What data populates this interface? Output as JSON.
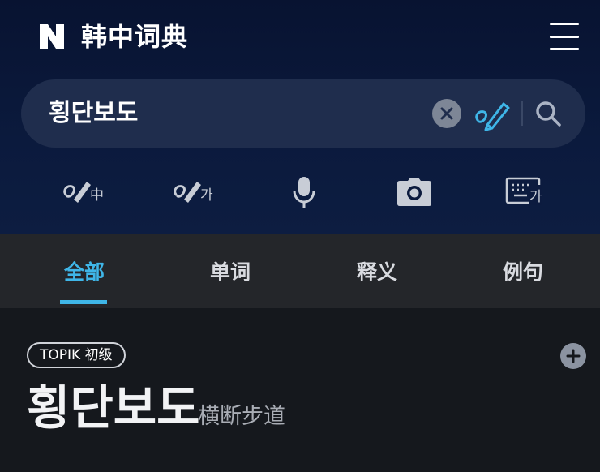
{
  "app": {
    "logo_icon": "naver-n-logo-icon",
    "title": "韩中词典",
    "menu_icon": "hamburger-menu-icon"
  },
  "search": {
    "query": "횡단보도",
    "clear_icon": "clear-icon",
    "handwriting_icon": "handwriting-pen-icon",
    "search_icon": "search-icon"
  },
  "input_tools": [
    {
      "name": "chinese-handwriting-icon",
      "sub": "中"
    },
    {
      "name": "korean-handwriting-icon",
      "sub": "가"
    },
    {
      "name": "microphone-icon"
    },
    {
      "name": "camera-icon"
    },
    {
      "name": "korean-keyboard-icon",
      "sub": "가"
    }
  ],
  "tabs": [
    {
      "label": "全部",
      "active": true
    },
    {
      "label": "单词",
      "active": false
    },
    {
      "label": "释义",
      "active": false
    },
    {
      "label": "例句",
      "active": false
    }
  ],
  "entry": {
    "badge": "TOPIK 初级",
    "word": "횡단보도",
    "hanja": "横断步道",
    "add_icon": "plus-icon"
  },
  "colors": {
    "header_bg": "#0b1a3d",
    "accent": "#3fb6e8",
    "tab_bar_bg": "#24262a",
    "content_bg": "#15181d"
  }
}
